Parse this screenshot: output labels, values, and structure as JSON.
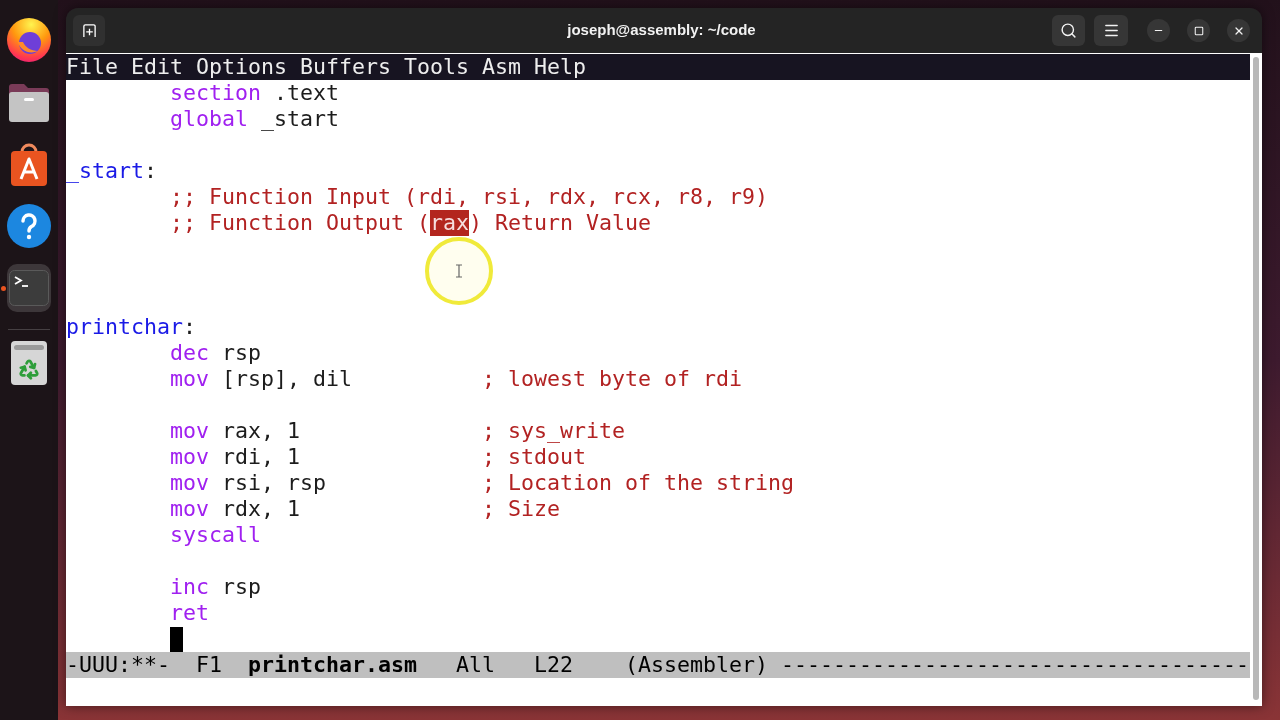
{
  "dock": [
    {
      "kind": "browser",
      "active": false
    },
    {
      "kind": "files",
      "active": false
    },
    {
      "kind": "software",
      "active": false
    },
    {
      "kind": "help",
      "active": false
    },
    {
      "kind": "terminal",
      "active": true
    },
    {
      "kind": "trash",
      "active": false
    }
  ],
  "window": {
    "title": "joseph@assembly: ~/code"
  },
  "menu_bar": [
    "File",
    "Edit",
    "Options",
    "Buffers",
    "Tools",
    "Asm",
    "Help"
  ],
  "editor": {
    "lines": [
      {
        "kind": "instruction",
        "op": "section",
        "args": ".text"
      },
      {
        "kind": "instruction",
        "op": "global",
        "args": "_start"
      },
      {
        "kind": "blank",
        "cursor": false
      },
      {
        "kind": "label",
        "name": "_start",
        "colon": ":"
      },
      {
        "kind": "comment",
        "parts": [
          {
            "text": ";; Function Input (rdi, rsi, rdx, rcx, r8, r9)",
            "selected": false
          }
        ]
      },
      {
        "kind": "comment",
        "parts": [
          {
            "text": ";; Function Output (",
            "selected": false
          },
          {
            "text": "rax",
            "selected": true
          },
          {
            "text": ") Return Value",
            "selected": false
          }
        ]
      },
      {
        "kind": "blank",
        "cursor": false
      },
      {
        "kind": "blank",
        "cursor": false
      },
      {
        "kind": "blank",
        "cursor": false
      },
      {
        "kind": "label",
        "name": "printchar",
        "colon": ":"
      },
      {
        "kind": "instruction",
        "op": "dec",
        "args": "rsp"
      },
      {
        "kind": "instruction",
        "op": "mov",
        "args": "[rsp], dil",
        "comment": "; lowest byte of rdi"
      },
      {
        "kind": "blank",
        "cursor": false
      },
      {
        "kind": "instruction",
        "op": "mov",
        "args": "rax, 1",
        "comment": "; sys_write"
      },
      {
        "kind": "instruction",
        "op": "mov",
        "args": "rdi, 1",
        "comment": "; stdout"
      },
      {
        "kind": "instruction",
        "op": "mov",
        "args": "rsi, rsp",
        "comment": "; Location of the string"
      },
      {
        "kind": "instruction",
        "op": "mov",
        "args": "rdx, 1",
        "comment": "; Size"
      },
      {
        "kind": "instruction",
        "op": "syscall"
      },
      {
        "kind": "blank",
        "cursor": false
      },
      {
        "kind": "instruction",
        "op": "inc",
        "args": "rsp"
      },
      {
        "kind": "instruction",
        "op": "ret"
      },
      {
        "kind": "blank",
        "cursor": true
      }
    ]
  },
  "mode_line": {
    "status": "-UUU:**-",
    "frame": "F1",
    "buffer": "printchar.asm",
    "position": "All",
    "line": "L22",
    "mode": "(Assembler)",
    "fill": "------------------------------------"
  }
}
